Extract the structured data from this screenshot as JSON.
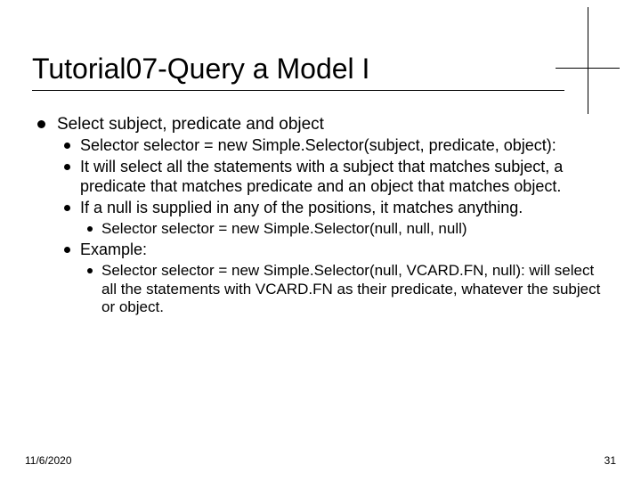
{
  "title": "Tutorial07-Query a Model I",
  "level0": {
    "text": "Select subject, predicate and object",
    "items": [
      {
        "text": "Selector selector = new Simple.Selector(subject, predicate, object):"
      },
      {
        "text": "It will select all the statements with a subject that matches subject, a predicate that matches predicate and an object that matches object."
      },
      {
        "text": "If a null is supplied in any of the positions, it matches anything.",
        "sub": [
          {
            "text": "Selector selector = new Simple.Selector(null, null, null)"
          }
        ]
      },
      {
        "text": "Example:",
        "sub": [
          {
            "text": "Selector selector = new Simple.Selector(null, VCARD.FN, null): will select all the statements with VCARD.FN as their predicate, whatever the subject or object."
          }
        ]
      }
    ]
  },
  "footer": {
    "date": "11/6/2020",
    "page": "31"
  }
}
